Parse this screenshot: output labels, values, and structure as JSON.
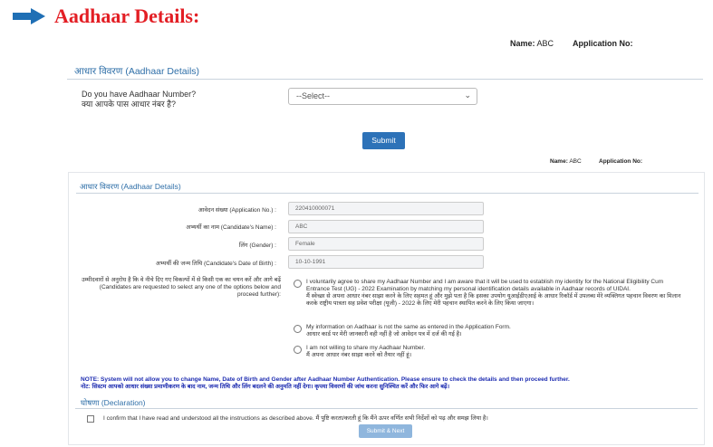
{
  "heading": {
    "icon": "arrow-right-icon",
    "arrow_color": "#1f6fb5",
    "text": "Aadhaar Details:",
    "text_color": "#e31e24"
  },
  "top_info": {
    "name_label": "Name:",
    "name_value": "ABC",
    "appno_label": "Application No:",
    "appno_value": ""
  },
  "panel1": {
    "title": "आधार विवरण (Aadhaar Details)",
    "question_en": "Do you have Aadhaar Number?",
    "question_hi": "क्या आपके पास आधार नंबर है?",
    "select_value": "--Select--",
    "submit_label": "Submit"
  },
  "panel2_info": {
    "name_label": "Name:",
    "name_value": "ABC",
    "appno_label": "Application No:",
    "appno_value": ""
  },
  "panel2": {
    "title": "आधार विवरण (Aadhaar Details)",
    "fields": [
      {
        "label": "आवेदन संख्या (Application No.) :",
        "value": "220410000071"
      },
      {
        "label": "अभ्यर्थी का नाम (Candidate's Name) :",
        "value": "ABC"
      },
      {
        "label": "लिंग (Gender) :",
        "value": "Female"
      },
      {
        "label": "अभ्यर्थी की जन्म तिथि (Candidate's Date of Birth) :",
        "value": "10-10-1991"
      }
    ],
    "instruction": "उम्मीदवारों से अनुरोध है कि वे नीचे दिए गए विकल्पों में से किसी एक का चयन करें और आगे बढ़ें (Candidates are requested to select any one of the options below and proceed further):",
    "options": [
      {
        "en": "I voluntarily agree to share my Aadhaar Number and I am aware that it will be used to establish my identity for the National Eligibility Cum Entrance Test (UG) - 2022 Examination by matching my personal identification details available in Aadhaar records of UIDAI.",
        "hi": "मैं स्वेच्छा से अपना आधार नंबर साझा करने के लिए सहमत हूं और मुझे पता है कि इसका उपयोग यूआईडीएआई के आधार रिकॉर्ड में उपलब्ध मेरे व्यक्तिगत पहचान विवरण का मिलान करके राष्ट्रीय पात्रता सह प्रवेश परीक्षा (यूजी) - 2022 के लिए मेरी पहचान स्थापित करने के लिए किया जाएगा।"
      },
      {
        "en": "My information on Aadhaar is not the same as entered in the Application Form.",
        "hi": "आधार कार्ड पर मेरी जानकारी वही नहीं है जो आवेदन पत्र में दर्ज की गई है।"
      },
      {
        "en": "I am not willing to share my Aadhaar Number.",
        "hi": "मैं अपना आधार नंबर साझा करने को तैयार नहीं हूं।"
      }
    ],
    "note_en": "NOTE: System will not allow you to change Name, Date of Birth and Gender after Aadhaar Number Authentication. Please ensure to check the details and then proceed further.",
    "note_hi": "नोट: सिस्टम आपको आधार संख्या प्रमाणीकरण के बाद नाम, जन्म तिथि और लिंग बदलने की अनुमति नहीं देगा। कृपया विवरणों की जांच करना सुनिश्चित करें और फिर आगे बढ़ें।",
    "declaration_title": "घोषणा (Declaration)",
    "declaration_text": "I confirm that I have read and understood all the instructions as described above. मैं पुष्टि करता/करती हूं कि मैंने ऊपर वर्णित सभी निर्देशों को पढ़ और समझ लिया है।",
    "submit_next_label": "Submit & Next"
  },
  "colors": {
    "accent_blue": "#2d72b8",
    "section_title": "#2f6fa8",
    "note_blue": "#1c2bb0",
    "heading_red": "#e31e24"
  }
}
